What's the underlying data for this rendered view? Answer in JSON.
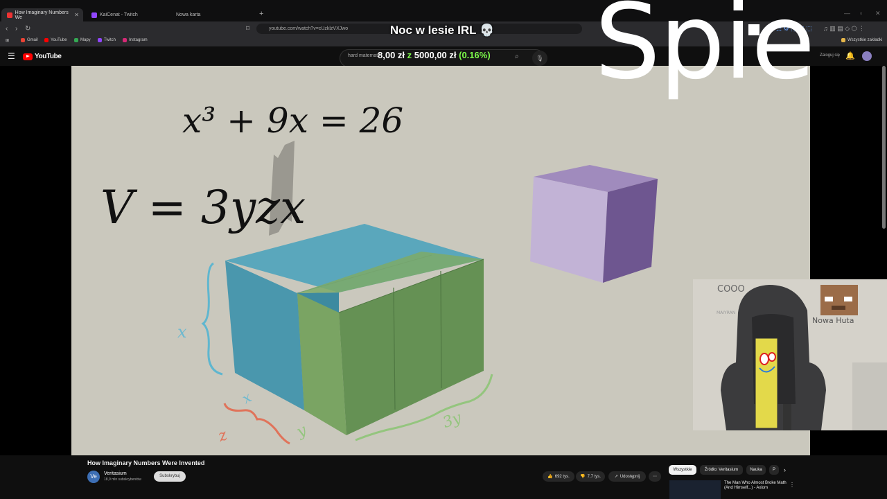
{
  "browser": {
    "tabs": [
      {
        "label": "How Imaginary Numbers We",
        "active": true
      },
      {
        "label": "KaiCenat - Twitch",
        "active": false
      },
      {
        "label": "Nowa karta",
        "active": false
      }
    ],
    "new_tab": "+",
    "url": "youtube.com/watch?v=cUzklzVXJwo",
    "bookmarks": [
      "Gmail",
      "YouTube",
      "Mapy",
      "Twitch",
      "Instagram"
    ],
    "all_bookmarks": "Wszystkie zakładki"
  },
  "stream": {
    "title": "Noc w lesie IRL 💀",
    "sleep_text": "Śpie",
    "donation": {
      "current": "8,00 zł",
      "sep": "z",
      "goal": "5000,00 zł",
      "pct": "(0.16%)"
    }
  },
  "youtube": {
    "logo": "YouTube",
    "search_placeholder": "hard matemat",
    "login_label": "Zaloguj się"
  },
  "slide": {
    "equation1": "x³ + 9x = 26",
    "equation2": "V = 3yzx",
    "labels": {
      "x_side": "x",
      "x_depth": "x",
      "z": "z",
      "y": "y",
      "y3": "3y"
    }
  },
  "webcam": {
    "wall_text_1": "COOO",
    "wall_text_2": "Nowa Huta",
    "wall_text_3": "MAIYRAN"
  },
  "video_info": {
    "title": "How Imaginary Numbers Were Invented",
    "channel": "Veritasium",
    "channel_initials": "Ve",
    "subscribers": "18,9 mln subskrybentów",
    "subscribe_label": "Subskrybuj",
    "likes": "692 tys.",
    "dislikes": "7,7 tys.",
    "share_label": "Udostępnij",
    "more": "⋯"
  },
  "chips": [
    "Wszystkie",
    "Źródło: Veritasium",
    "Nauka",
    "P"
  ],
  "recommended": {
    "title": "The Man Who Almost Broke Math (And Himself...) - Axiom"
  },
  "colors": {
    "slide_bg": "#cac8bd",
    "cube_blue": "#4f9bb0",
    "cube_green": "#6f9a58",
    "cube_purple": "#8b73a8",
    "brace_blue": "#5fb6cf",
    "brace_red": "#e0735a",
    "brace_green": "#94c57e",
    "donation_green": "#7dfc4a"
  }
}
